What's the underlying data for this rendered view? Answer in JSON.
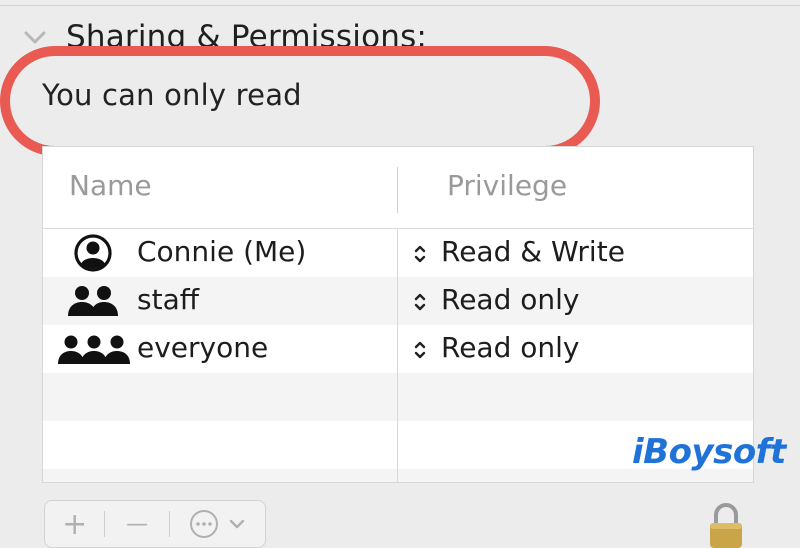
{
  "section": {
    "title": "Sharing & Permissions:",
    "status": "You can only read"
  },
  "table": {
    "columns": {
      "name": "Name",
      "privilege": "Privilege"
    },
    "rows": [
      {
        "name": "Connie (Me)",
        "privilege": "Read & Write",
        "icon": "person-circle-icon"
      },
      {
        "name": "staff",
        "privilege": "Read only",
        "icon": "two-people-icon"
      },
      {
        "name": "everyone",
        "privilege": "Read only",
        "icon": "three-people-icon"
      }
    ]
  },
  "toolbar": {
    "add": "+",
    "remove": "—",
    "actions_icon": "ellipsis-circle-icon"
  },
  "watermark": "iBoysoft",
  "colors": {
    "highlight": "#e85a52",
    "watermark": "#1e72d8"
  }
}
